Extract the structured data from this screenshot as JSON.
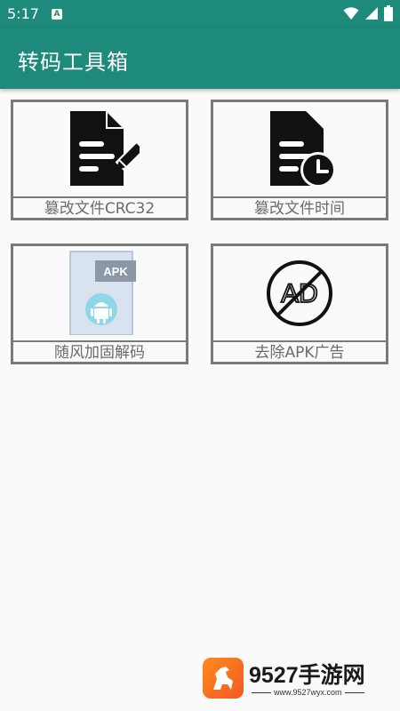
{
  "status_bar": {
    "time": "5:17",
    "notification_icon": "A",
    "icons": [
      "wifi-icon",
      "signal-icon",
      "battery-icon"
    ]
  },
  "app_bar": {
    "title": "转码工具箱",
    "color": "#1d8a7b"
  },
  "tiles": [
    {
      "label": "篡改文件CRC32",
      "icon": "file-edit-icon"
    },
    {
      "label": "篡改文件时间",
      "icon": "file-clock-icon"
    },
    {
      "label": "随风加固解码",
      "icon": "apk-file-icon",
      "badge": "APK"
    },
    {
      "label": "去除APK广告",
      "icon": "no-ad-icon",
      "badge": "AD"
    }
  ],
  "watermark": {
    "name": "9527手游网",
    "url": "www.9527wyx.com"
  }
}
